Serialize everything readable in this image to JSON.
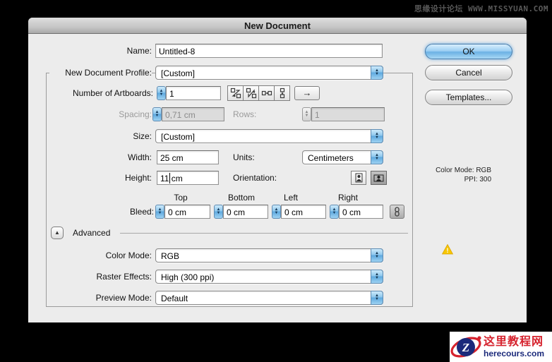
{
  "watermark": "思缘设计论坛 WWW.MISSYUAN.COM",
  "dialog": {
    "title": "New Document",
    "fields": {
      "name_label": "Name:",
      "name_value": "Untitled-8",
      "profile_label": "New Document Profile:",
      "profile_value": "[Custom]",
      "artboards_label": "Number of Artboards:",
      "artboards_value": "1",
      "spacing_label": "Spacing:",
      "spacing_value": "0,71 cm",
      "rows_label": "Rows:",
      "rows_value": "1",
      "size_label": "Size:",
      "size_value": "[Custom]",
      "width_label": "Width:",
      "width_value": "25 cm",
      "units_label": "Units:",
      "units_value": "Centimeters",
      "height_label": "Height:",
      "height_value": "11 cm",
      "orientation_label": "Orientation:",
      "bleed_label": "Bleed:",
      "bleed_columns": [
        "Top",
        "Bottom",
        "Left",
        "Right"
      ],
      "bleed_values": [
        "0 cm",
        "0 cm",
        "0 cm",
        "0 cm"
      ],
      "advanced_label": "Advanced",
      "color_mode_label": "Color Mode:",
      "color_mode_value": "RGB",
      "raster_label": "Raster Effects:",
      "raster_value": "High (300 ppi)",
      "preview_label": "Preview Mode:",
      "preview_value": "Default"
    },
    "buttons": {
      "ok": "OK",
      "cancel": "Cancel",
      "templates": "Templates..."
    },
    "info": {
      "color_mode": "Color Mode: RGB",
      "ppi": "PPI: 300"
    },
    "arrow_button": "→"
  },
  "logo": {
    "title": "这里教程网",
    "domain": "herecours.com",
    "letter": "Z"
  },
  "colors": {
    "accent_blue": "#6cb1e4",
    "disabled_gray": "#dcdcdc",
    "warning_yellow": "#f7c600",
    "logo_red": "#d6232e",
    "logo_navy": "#1b2a7b",
    "background": "#000000",
    "dialog_gray": "#ececec"
  }
}
